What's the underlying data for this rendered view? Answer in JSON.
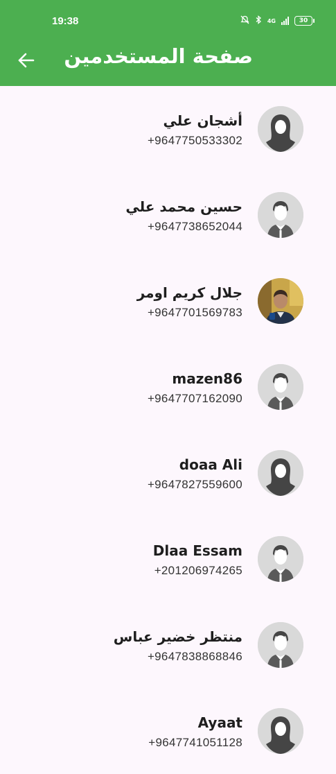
{
  "status_bar": {
    "time": "19:38",
    "battery": "30",
    "network": "4G"
  },
  "header": {
    "title": "صفحة المستخدمين"
  },
  "users": [
    {
      "name": "أشجان علي",
      "phone": "+9647750533302",
      "avatar": "female-avatar"
    },
    {
      "name": "حسين محمد علي",
      "phone": "+9647738652044",
      "avatar": "male-avatar"
    },
    {
      "name": "جلال كريم اومر",
      "phone": "+9647701569783",
      "avatar": "photo-avatar"
    },
    {
      "name": "mazen86",
      "phone": "+9647707162090",
      "avatar": "male-avatar"
    },
    {
      "name": "doaa Ali",
      "phone": "+9647827559600",
      "avatar": "female-avatar"
    },
    {
      "name": "Dlaa Essam",
      "phone": "+201206974265",
      "avatar": "male-avatar"
    },
    {
      "name": "منتظر خضير عباس",
      "phone": "+9647838868846",
      "avatar": "male-avatar"
    },
    {
      "name": "Ayaat",
      "phone": "+9647741051128",
      "avatar": "female-avatar"
    }
  ]
}
